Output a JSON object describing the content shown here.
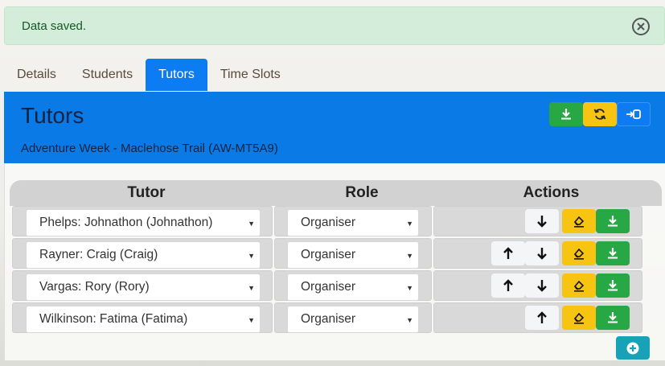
{
  "alert": {
    "message": "Data saved."
  },
  "tabs": [
    {
      "label": "Details",
      "active": false
    },
    {
      "label": "Students",
      "active": false
    },
    {
      "label": "Tutors",
      "active": true
    },
    {
      "label": "Time Slots",
      "active": false
    }
  ],
  "panel": {
    "title": "Tutors",
    "subtitle": "Adventure Week - Maclehose Trail (AW-MT5A9)",
    "buttons": [
      "download-icon",
      "refresh-icon",
      "exit-icon"
    ]
  },
  "table": {
    "headers": {
      "tutor": "Tutor",
      "role": "Role",
      "actions": "Actions"
    },
    "rows": [
      {
        "tutor": "Phelps: Johnathon (Johnathon)",
        "role": "Organiser"
      },
      {
        "tutor": "Rayner: Craig (Craig)",
        "role": "Organiser"
      },
      {
        "tutor": "Vargas: Rory (Rory)",
        "role": "Organiser"
      },
      {
        "tutor": "Wilkinson: Fatima (Fatima)",
        "role": "Organiser"
      }
    ]
  },
  "colors": {
    "primary": "#0a7ae6",
    "success": "#28a745",
    "warning": "#f6c411",
    "info": "#17a2b8",
    "alert_bg": "#d4eddb"
  }
}
